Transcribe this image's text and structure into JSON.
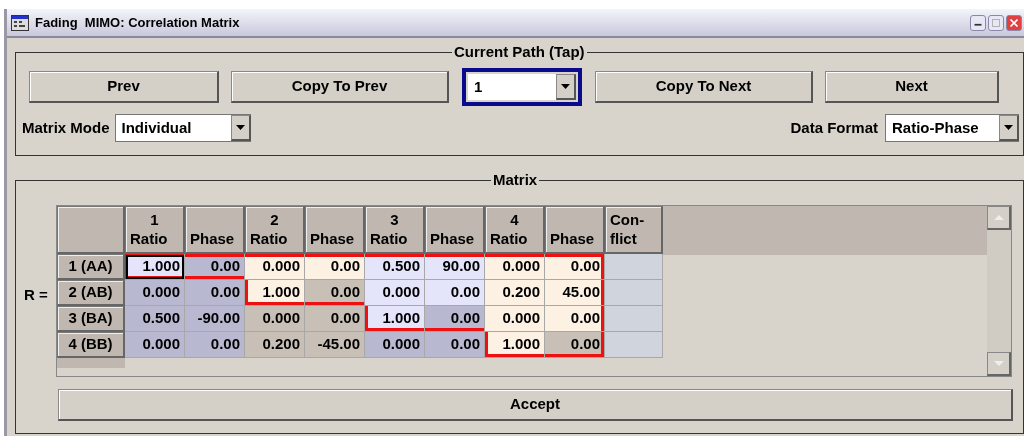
{
  "window": {
    "title": "Fading  MIMO: Correlation Matrix"
  },
  "path_group": {
    "title": "Current Path (Tap)",
    "buttons": [
      "Prev",
      "Copy To Prev",
      "Copy To Next",
      "Next"
    ],
    "path_select": {
      "value": "1",
      "focused": true
    },
    "matrix_mode": {
      "label": "Matrix Mode",
      "value": "Individual"
    },
    "data_format": {
      "label": "Data Format",
      "value": "Ratio-Phase"
    }
  },
  "matrix_group": {
    "title": "Matrix",
    "r_label": "R =",
    "columns": [
      {
        "number": "1",
        "label": "Ratio"
      },
      {
        "label": "Phase"
      },
      {
        "number": "2",
        "label": "Ratio"
      },
      {
        "label": "Phase"
      },
      {
        "number": "3",
        "label": "Ratio"
      },
      {
        "label": "Phase"
      },
      {
        "number": "4",
        "label": "Ratio"
      },
      {
        "label": "Phase"
      },
      {
        "label": "Con-flict"
      }
    ],
    "rows": [
      {
        "label": "1 (AA)",
        "cells": [
          {
            "value": "1.000",
            "editable": true,
            "selected": true
          },
          {
            "value": "0.00",
            "editable": false,
            "selected": false
          },
          {
            "value": "0.000",
            "editable": true,
            "selected": false
          },
          {
            "value": "0.00",
            "editable": true,
            "selected": false
          },
          {
            "value": "0.500",
            "editable": true,
            "selected": false
          },
          {
            "value": "90.00",
            "editable": true,
            "selected": false
          },
          {
            "value": "0.000",
            "editable": true,
            "selected": false
          },
          {
            "value": "0.00",
            "editable": true,
            "selected": false
          }
        ]
      },
      {
        "label": "2 (AB)",
        "cells": [
          {
            "value": "0.000",
            "editable": false,
            "selected": false
          },
          {
            "value": "0.00",
            "editable": false,
            "selected": false
          },
          {
            "value": "1.000",
            "editable": true,
            "selected": false
          },
          {
            "value": "0.00",
            "editable": false,
            "selected": false
          },
          {
            "value": "0.000",
            "editable": true,
            "selected": false
          },
          {
            "value": "0.00",
            "editable": true,
            "selected": false
          },
          {
            "value": "0.200",
            "editable": true,
            "selected": false
          },
          {
            "value": "45.00",
            "editable": true,
            "selected": false
          }
        ]
      },
      {
        "label": "3 (BA)",
        "cells": [
          {
            "value": "0.500",
            "editable": false,
            "selected": false
          },
          {
            "value": "-90.00",
            "editable": false,
            "selected": false
          },
          {
            "value": "0.000",
            "editable": false,
            "selected": false
          },
          {
            "value": "0.00",
            "editable": false,
            "selected": false
          },
          {
            "value": "1.000",
            "editable": true,
            "selected": false
          },
          {
            "value": "0.00",
            "editable": false,
            "selected": false
          },
          {
            "value": "0.000",
            "editable": true,
            "selected": false
          },
          {
            "value": "0.00",
            "editable": true,
            "selected": false
          }
        ]
      },
      {
        "label": "4 (BB)",
        "cells": [
          {
            "value": "0.000",
            "editable": false,
            "selected": false
          },
          {
            "value": "0.00",
            "editable": false,
            "selected": false
          },
          {
            "value": "0.200",
            "editable": false,
            "selected": false
          },
          {
            "value": "-45.00",
            "editable": false,
            "selected": false
          },
          {
            "value": "0.000",
            "editable": false,
            "selected": false
          },
          {
            "value": "0.00",
            "editable": false,
            "selected": false
          },
          {
            "value": "1.000",
            "editable": true,
            "selected": false
          },
          {
            "value": "0.00",
            "editable": false,
            "selected": false
          }
        ]
      }
    ],
    "accept_button": "Accept"
  }
}
